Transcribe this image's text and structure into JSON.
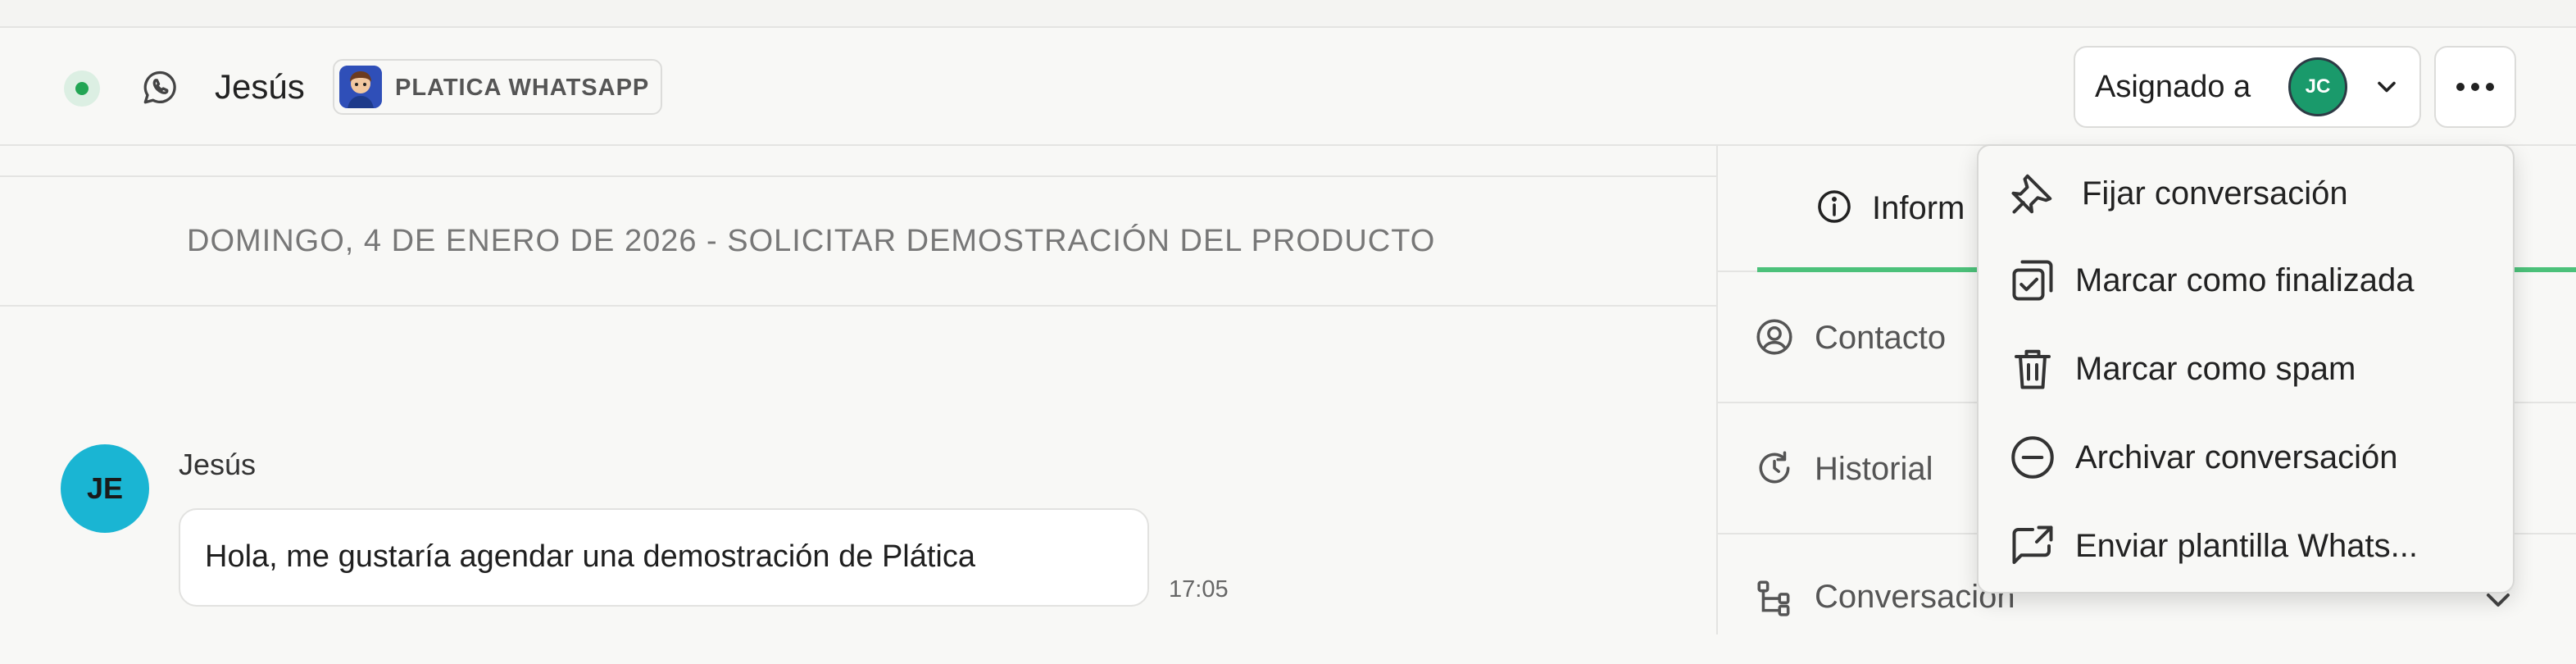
{
  "header": {
    "contact_name": "Jesús",
    "channel_badge": "PLATICA WHATSAPP",
    "assign_label": "Asignado a",
    "assignee_initials": "JC"
  },
  "chat": {
    "date_banner": "DOMINGO, 4 DE ENERO DE 2026 - SOLICITAR DEMOSTRACIÓN DEL PRODUCTO",
    "message": {
      "avatar_initials": "JE",
      "sender": "Jesús",
      "text": "Hola, me gustaría agendar una demostración de Plática",
      "time": "17:05"
    }
  },
  "sidebar": {
    "active_tab": "Inform",
    "sections": [
      "Contacto",
      "Historial",
      "Conversación"
    ]
  },
  "menu": {
    "items": [
      {
        "label": "Fijar conversación",
        "icon": "pin-icon"
      },
      {
        "label": "Marcar como finalizada",
        "icon": "check-square-icon"
      },
      {
        "label": "Marcar como spam",
        "icon": "trash-icon"
      },
      {
        "label": "Archivar conversación",
        "icon": "minus-circle-icon"
      },
      {
        "label": "Enviar plantilla Whats...",
        "icon": "share-message-icon"
      }
    ]
  },
  "colors": {
    "status_online": "#22a554",
    "active_tab_underline": "#4cc17a",
    "assignee_avatar": "#1a9a6b",
    "message_avatar": "#1ab5d3"
  }
}
